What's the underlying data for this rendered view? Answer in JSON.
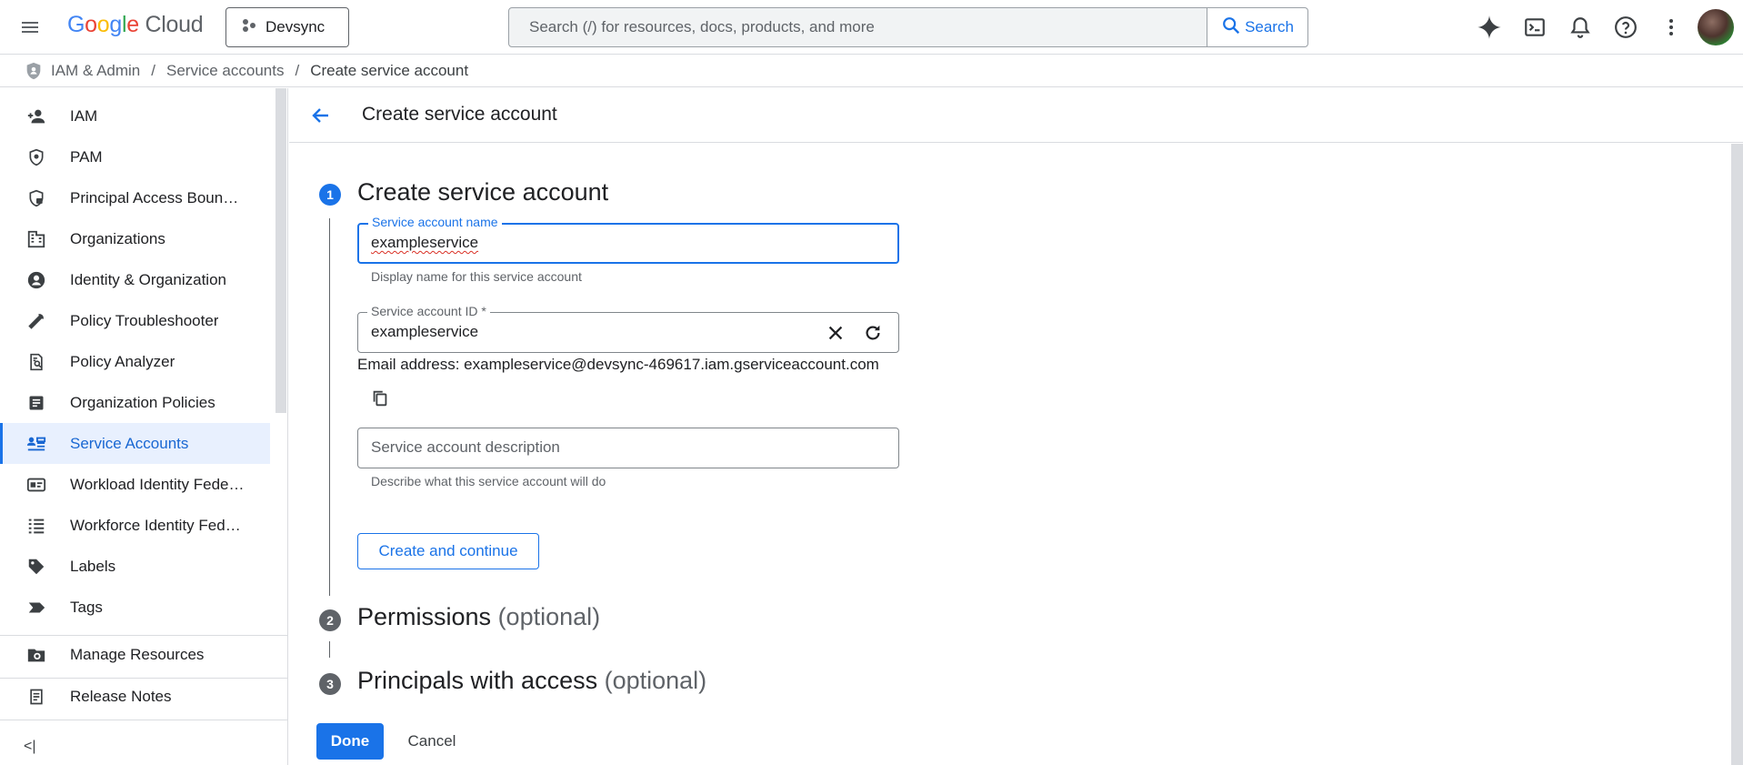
{
  "topbar": {
    "logo_google": "Google",
    "logo_cloud": "Cloud",
    "project_name": "Devsync",
    "search_placeholder": "Search (/) for resources, docs, products, and more",
    "search_button": "Search",
    "icons": [
      "gemini-sparkle-icon",
      "cloud-shell-icon",
      "notifications-icon",
      "help-icon",
      "more-vert-icon"
    ]
  },
  "breadcrumb": {
    "items": [
      "IAM & Admin",
      "Service accounts",
      "Create service account"
    ],
    "separator": "/"
  },
  "sidebar": {
    "items": [
      {
        "label": "IAM",
        "icon": "person-add-icon"
      },
      {
        "label": "PAM",
        "icon": "shield-icon"
      },
      {
        "label": "Principal Access Boun…",
        "icon": "shield-lock-icon"
      },
      {
        "label": "Organizations",
        "icon": "domain-icon"
      },
      {
        "label": "Identity & Organization",
        "icon": "account-circle-icon"
      },
      {
        "label": "Policy Troubleshooter",
        "icon": "wrench-icon"
      },
      {
        "label": "Policy Analyzer",
        "icon": "document-search-icon"
      },
      {
        "label": "Organization Policies",
        "icon": "list-doc-icon"
      },
      {
        "label": "Service Accounts",
        "icon": "service-account-icon"
      },
      {
        "label": "Workload Identity Fede…",
        "icon": "id-card-icon"
      },
      {
        "label": "Workforce Identity Fed…",
        "icon": "list-icon"
      },
      {
        "label": "Labels",
        "icon": "label-icon"
      },
      {
        "label": "Tags",
        "icon": "tag-icon"
      },
      {
        "label": "Manage Resources",
        "icon": "folder-settings-icon"
      },
      {
        "label": "Release Notes",
        "icon": "release-notes-icon"
      }
    ],
    "active_index": 8,
    "collapse_label": "<|"
  },
  "page": {
    "title": "Create service account"
  },
  "steps": [
    {
      "number": "1",
      "title": "Create service account",
      "optional": ""
    },
    {
      "number": "2",
      "title": "Permissions",
      "optional": "(optional)"
    },
    {
      "number": "3",
      "title": "Principals with access",
      "optional": "(optional)"
    }
  ],
  "form": {
    "name_label": "Service account name",
    "name_value": "exampleservice",
    "name_helper": "Display name for this service account",
    "id_label": "Service account ID *",
    "id_value": "exampleservice",
    "email_label": "Email address:",
    "email_value": "exampleservice@devsync-469617.iam.gserviceaccount.com",
    "description_placeholder": "Service account description",
    "description_helper": "Describe what this service account will do",
    "create_button": "Create and continue"
  },
  "footer": {
    "done_button": "Done",
    "cancel_button": "Cancel"
  },
  "colors": {
    "accent": "#1a73e8",
    "active_bg": "#e8f0fe",
    "step_active": "#1a73e8",
    "step_inactive": "#5f6368"
  }
}
